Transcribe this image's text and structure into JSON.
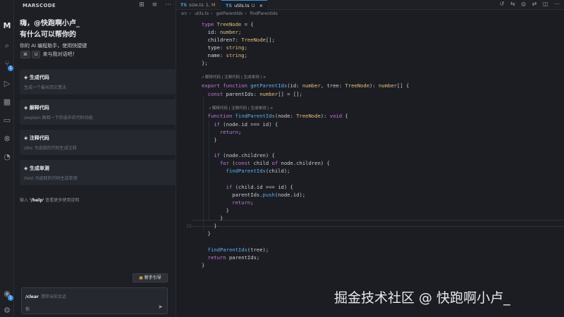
{
  "activity_bar": {
    "items": [
      {
        "name": "marscode-logo-icon",
        "glyph": "M"
      },
      {
        "name": "search-icon",
        "glyph": "⌕"
      },
      {
        "name": "source-control-icon",
        "glyph": "⑂",
        "badge": "1"
      },
      {
        "name": "run-debug-icon",
        "glyph": "▷"
      },
      {
        "name": "extensions-icon",
        "glyph": "▦"
      },
      {
        "name": "remote-icon",
        "glyph": "▭"
      },
      {
        "name": "git-graph-icon",
        "glyph": "⊗"
      },
      {
        "name": "timeline-icon",
        "glyph": "◔"
      }
    ],
    "bottom": [
      {
        "name": "account-icon",
        "glyph": "◉",
        "badge": "1"
      },
      {
        "name": "settings-icon",
        "glyph": "⚙"
      }
    ]
  },
  "panel": {
    "title": "MARSCODE",
    "actions": [
      "⊞",
      "≡",
      "⋯"
    ],
    "greeting_line1": "嗨，@快跑啊小卢_",
    "greeting_line2": "有什么可以帮你的",
    "intro_line1": "你的 AI 编程助手，使用快捷键",
    "intro_key1": "⌘",
    "intro_key2": "U",
    "intro_line2_suffix": "来与我对话吧！",
    "cards": [
      {
        "icon": "◈",
        "title": "生成代码",
        "desc": "生成一个最长回文算法"
      },
      {
        "icon": "◈",
        "title": "解释代码",
        "desc": "/explain 解释一下你选中的代码功能"
      },
      {
        "icon": "◈",
        "title": "注释代码",
        "desc": "/doc 为选取的代码生成注释"
      },
      {
        "icon": "◈",
        "title": "生成单测",
        "desc": "/test 为选取的代码生成单测"
      }
    ],
    "help_prefix": "输入",
    "help_cmd": "'/help'",
    "help_suffix": "查看更多使用说明",
    "guide_button": "新手引导",
    "guide_icon": "▣",
    "input_cmd": "/clear",
    "input_cmd_desc": "清除当前会话",
    "input_placeholder": "你",
    "send_icon": "➤"
  },
  "editor": {
    "tabs": [
      {
        "lang": "TS",
        "label": "size.ts",
        "status": "1, M"
      },
      {
        "lang": "TS",
        "label": "utils.ts",
        "status": "U",
        "close": "×"
      }
    ],
    "tab_actions": [
      "↺",
      "⇆",
      "◎",
      "⇄",
      "◫",
      "⋯"
    ],
    "breadcrumbs": [
      "src",
      "utils.ts",
      "getParentIds",
      "findParentIds"
    ],
    "lens_text": "解释代码 | 注释代码 | 生成单测 | ×",
    "lines": [
      {
        "n": "",
        "code": ""
      }
    ]
  },
  "watermark": "掘金技术社区 @ 快跑啊小卢_"
}
